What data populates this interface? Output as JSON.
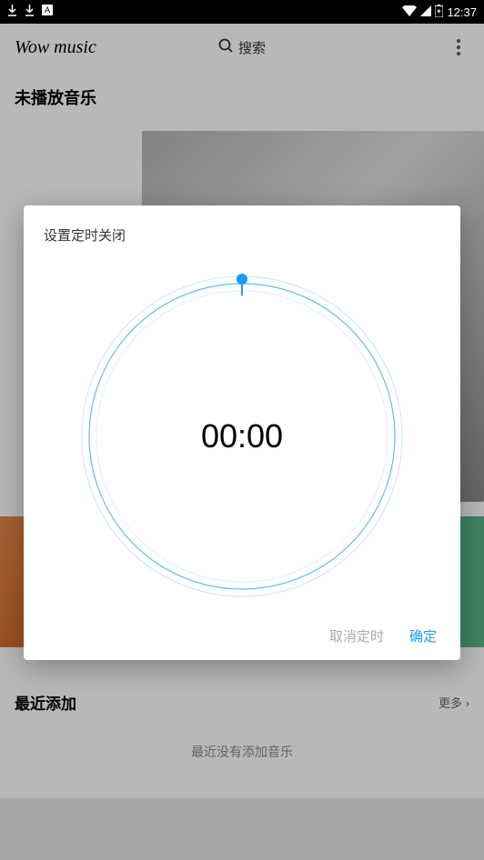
{
  "status": {
    "time": "12:37"
  },
  "header": {
    "app_title": "Wow music",
    "search_label": "搜索"
  },
  "sections": {
    "unplayed_title": "未播放音乐",
    "recent_title": "最近添加",
    "more_label": "更多",
    "empty_text": "最近没有添加音乐"
  },
  "dialog": {
    "title": "设置定时关闭",
    "time": "00:00",
    "cancel": "取消定时",
    "ok": "确定"
  }
}
